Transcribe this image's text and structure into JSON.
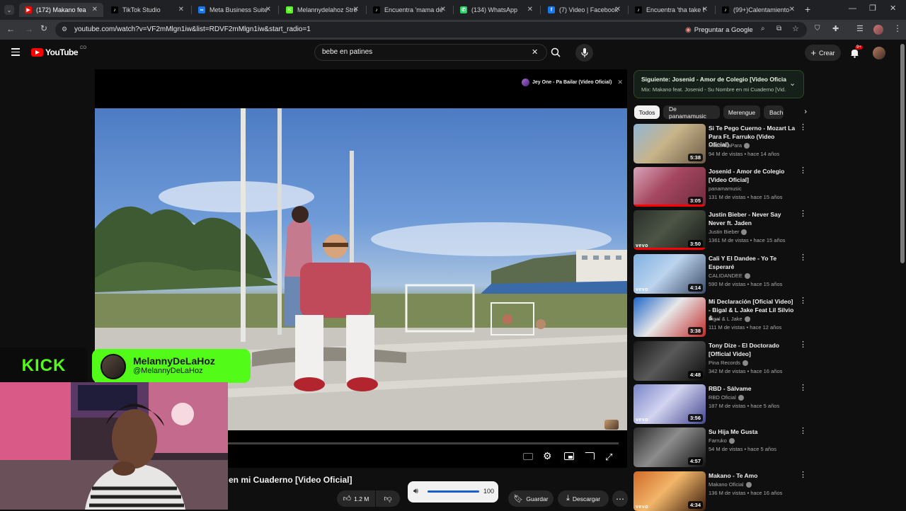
{
  "browser": {
    "tabs": [
      {
        "title": "(172) Makano fea",
        "active": true,
        "color": "#ff0000",
        "glyph": "▶"
      },
      {
        "title": "TikTok Studio",
        "color": "#000000",
        "glyph": "♪"
      },
      {
        "title": "Meta Business Suite",
        "color": "#1877f2",
        "glyph": "∞"
      },
      {
        "title": "Melannydelahoz Stre",
        "color": "#53fc18",
        "glyph": "K"
      },
      {
        "title": "Encuentra 'mama de",
        "color": "#000000",
        "glyph": "♪"
      },
      {
        "title": "(134) WhatsApp",
        "color": "#25d366",
        "glyph": "✆"
      },
      {
        "title": "(7) Video | Facebook",
        "color": "#1877f2",
        "glyph": "f"
      },
      {
        "title": "Encuentra 'tha take t",
        "color": "#000000",
        "glyph": "♪"
      },
      {
        "title": "(99+)Calentamiento",
        "color": "#000000",
        "glyph": "♪"
      }
    ],
    "new_tab": "+",
    "url": "youtube.com/watch?v=VF2mMlgn1iw&list=RDVF2mMlgn1iw&start_radio=1",
    "ask_google": "Preguntar a Google"
  },
  "youtube": {
    "logo": "YouTube",
    "country": "CO",
    "search_value": "bebe en patines",
    "create_label": "Crear",
    "notif_count": "9+",
    "next_label": "Siguiente: Josenid - Amor de Colegio [Video Oficial]",
    "next_mix": "Mix: Makano feat. Josenid - Su Nombre en mi Cuaderno [Vid...",
    "chips": [
      "Todos",
      "De panamamusic",
      "Merengue",
      "Bach"
    ],
    "overlay_title": "Jey One - Pa Bailar (Video Oficial)",
    "video_title_visible": "en mi Cuaderno [Video Oficial]",
    "likes": "1.2 M",
    "save_label": "Guardar",
    "download_label": "Descargar",
    "volume": "100",
    "volume_level": 1.0
  },
  "videos": [
    {
      "title": "Si Te Pego Cuerno - Mozart La Para Ft. Farruko (Video Oficial)",
      "channel": "MozartLaPara",
      "verified": true,
      "views": "94 M de vistas",
      "age": "hace 14 años",
      "duration": "5:38",
      "vevo": false,
      "watched": false,
      "colors": [
        "#8fb6d4",
        "#c9b48a",
        "#6a5a44"
      ]
    },
    {
      "title": "Josenid - Amor de Colegio [Video Oficial]",
      "channel": "panamamusic",
      "verified": false,
      "views": "131 M de vistas",
      "age": "hace 15 años",
      "duration": "3:05",
      "vevo": false,
      "watched": true,
      "colors": [
        "#d8a3b8",
        "#a5475f",
        "#6d2b3c"
      ]
    },
    {
      "title": "Justin Bieber - Never Say Never ft. Jaden",
      "channel": "Justin Bieber",
      "verified": true,
      "views": "1361 M de vistas",
      "age": "hace 15 años",
      "duration": "3:50",
      "vevo": true,
      "watched": true,
      "colors": [
        "#2a2f29",
        "#4d5546",
        "#161815"
      ]
    },
    {
      "title": "Cali Y El Dandee - Yo Te Esperaré",
      "channel": "CALIDANDEE",
      "verified": true,
      "views": "590 M de vistas",
      "age": "hace 15 años",
      "duration": "4:14",
      "vevo": true,
      "watched": false,
      "colors": [
        "#7fb0e0",
        "#bcd4ee",
        "#3a4a66"
      ]
    },
    {
      "title": "Mi Declaración [Oficial Video] - Bigal & L Jake Feat Lil Silvio & ...",
      "channel": "Bigal & L Jake",
      "verified": true,
      "views": "111 M de vistas",
      "age": "hace 12 años",
      "duration": "3:38",
      "vevo": false,
      "watched": false,
      "colors": [
        "#1d67c9",
        "#e7e7e7",
        "#c02a2a"
      ]
    },
    {
      "title": "Tony Dize - El Doctorado [Official Video]",
      "channel": "Pina Records",
      "verified": true,
      "views": "342 M de vistas",
      "age": "hace 16 años",
      "duration": "4:48",
      "vevo": false,
      "watched": false,
      "colors": [
        "#1a1a1a",
        "#595959",
        "#0b0b0b"
      ]
    },
    {
      "title": "RBD - Sálvame",
      "channel": "RBD Oficial",
      "verified": true,
      "views": "187 M de vistas",
      "age": "hace 5 años",
      "duration": "3:56",
      "vevo": true,
      "watched": false,
      "colors": [
        "#7a84c9",
        "#d2d4f0",
        "#43468e"
      ]
    },
    {
      "title": "Su Hija Me Gusta",
      "channel": "Farruko",
      "verified": true,
      "views": "54 M de vistas",
      "age": "hace 5 años",
      "duration": "4:57",
      "vevo": false,
      "watched": false,
      "colors": [
        "#2c2c2c",
        "#8c8c8c",
        "#121212"
      ]
    },
    {
      "title": "Makano - Te Amo",
      "channel": "Makano Oficial",
      "verified": true,
      "views": "136 M de vistas",
      "age": "hace 16 años",
      "duration": "4:34",
      "vevo": true,
      "watched": false,
      "colors": [
        "#d06a28",
        "#f2b66a",
        "#3a1c0c"
      ]
    }
  ],
  "stream": {
    "platform": "KICK",
    "name": "MelannyDeLaHoz",
    "handle": "@MelannyDeLaHoz",
    "accent": "#53fc18"
  }
}
